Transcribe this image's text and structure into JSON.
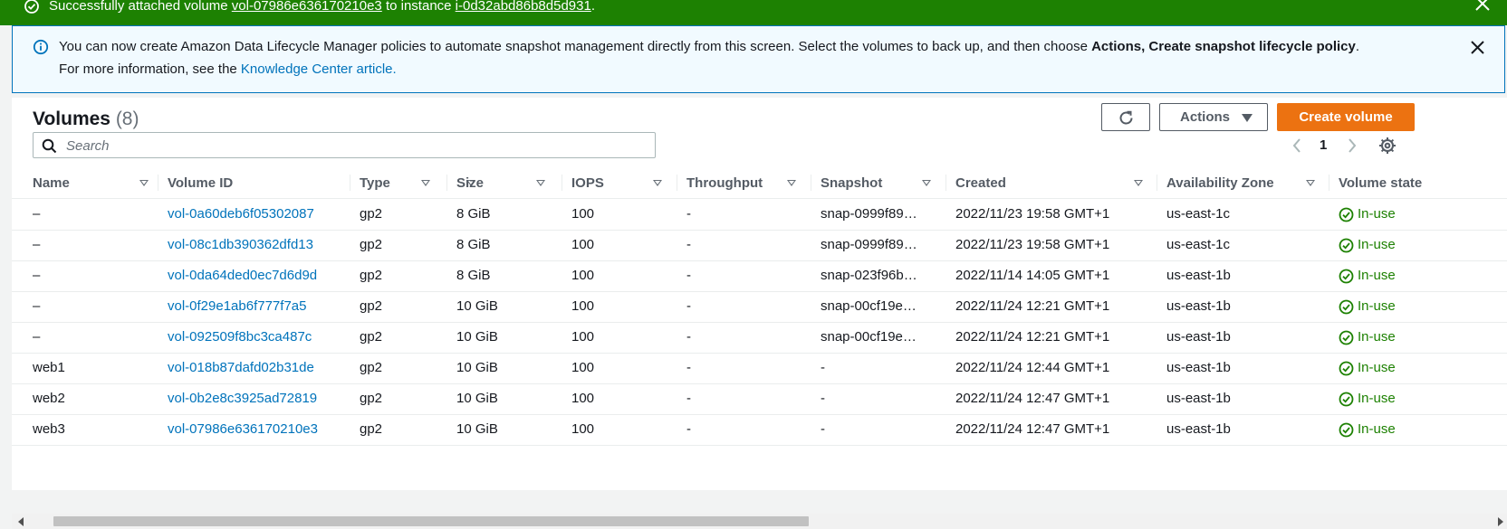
{
  "success": {
    "prefix": "Successfully attached volume",
    "volume_link": "vol-07986e636170210e3",
    "middle": "to instance",
    "instance_link": "i-0d32abd86b8d5d931",
    "suffix": "."
  },
  "info": {
    "line1_text": "You can now create Amazon Data Lifecycle Manager policies to automate snapshot management directly from this screen. Select the volumes to back up, and then choose ",
    "line1_bold": "Actions, Create snapshot lifecycle policy",
    "line1_end": ".",
    "line2_text": "For more information, see the ",
    "line2_link": "Knowledge Center article."
  },
  "panel": {
    "title": "Volumes",
    "count": "(8)",
    "actions_label": "Actions",
    "create_label": "Create volume",
    "search_placeholder": "Search",
    "page_number": "1"
  },
  "columns": [
    "Name",
    "Volume ID",
    "Type",
    "Size",
    "IOPS",
    "Throughput",
    "Snapshot",
    "Created",
    "Availability Zone",
    "Volume state"
  ],
  "rows": [
    {
      "name": "–",
      "volume_id": "vol-0a60deb6f05302087",
      "type": "gp2",
      "size": "8 GiB",
      "iops": "100",
      "throughput": "-",
      "snapshot": "snap-0999f89…",
      "created": "2022/11/23 19:58 GMT+1",
      "az": "us-east-1c",
      "state": "In-use"
    },
    {
      "name": "–",
      "volume_id": "vol-08c1db390362dfd13",
      "type": "gp2",
      "size": "8 GiB",
      "iops": "100",
      "throughput": "-",
      "snapshot": "snap-0999f89…",
      "created": "2022/11/23 19:58 GMT+1",
      "az": "us-east-1c",
      "state": "In-use"
    },
    {
      "name": "–",
      "volume_id": "vol-0da64ded0ec7d6d9d",
      "type": "gp2",
      "size": "8 GiB",
      "iops": "100",
      "throughput": "-",
      "snapshot": "snap-023f96b…",
      "created": "2022/11/14 14:05 GMT+1",
      "az": "us-east-1b",
      "state": "In-use"
    },
    {
      "name": "–",
      "volume_id": "vol-0f29e1ab6f777f7a5",
      "type": "gp2",
      "size": "10 GiB",
      "iops": "100",
      "throughput": "-",
      "snapshot": "snap-00cf19e…",
      "created": "2022/11/24 12:21 GMT+1",
      "az": "us-east-1b",
      "state": "In-use"
    },
    {
      "name": "–",
      "volume_id": "vol-092509f8bc3ca487c",
      "type": "gp2",
      "size": "10 GiB",
      "iops": "100",
      "throughput": "-",
      "snapshot": "snap-00cf19e…",
      "created": "2022/11/24 12:21 GMT+1",
      "az": "us-east-1b",
      "state": "In-use"
    },
    {
      "name": "web1",
      "volume_id": "vol-018b87dafd02b31de",
      "type": "gp2",
      "size": "10 GiB",
      "iops": "100",
      "throughput": "-",
      "snapshot": "-",
      "created": "2022/11/24 12:44 GMT+1",
      "az": "us-east-1b",
      "state": "In-use"
    },
    {
      "name": "web2",
      "volume_id": "vol-0b2e8c3925ad72819",
      "type": "gp2",
      "size": "10 GiB",
      "iops": "100",
      "throughput": "-",
      "snapshot": "-",
      "created": "2022/11/24 12:47 GMT+1",
      "az": "us-east-1b",
      "state": "In-use"
    },
    {
      "name": "web3",
      "volume_id": "vol-07986e636170210e3",
      "type": "gp2",
      "size": "10 GiB",
      "iops": "100",
      "throughput": "-",
      "snapshot": "-",
      "created": "2022/11/24 12:47 GMT+1",
      "az": "us-east-1b",
      "state": "In-use"
    }
  ],
  "colors": {
    "success_green": "#1d8102",
    "info_blue": "#0073bb",
    "primary_orange": "#ec7211"
  },
  "icons": {
    "success": "check-circle-icon",
    "info": "info-circle-icon",
    "close": "close-icon",
    "refresh": "refresh-icon",
    "search": "search-icon",
    "settings": "gear-icon",
    "state": "check-circle-icon"
  }
}
